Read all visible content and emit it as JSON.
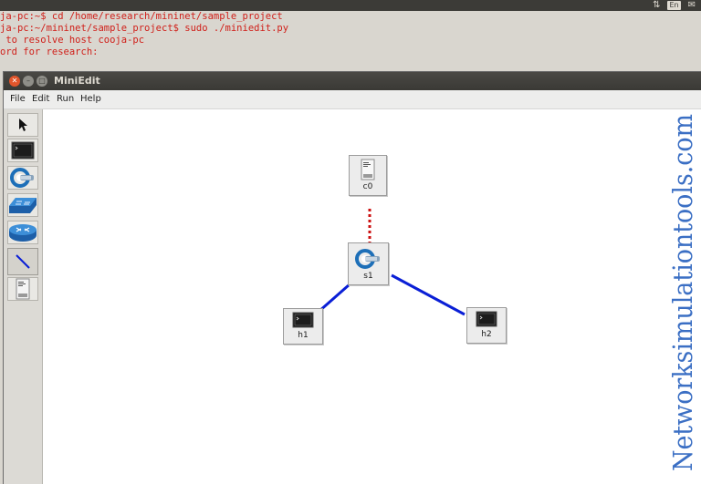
{
  "terminal": {
    "lines": [
      "ja-pc:~$ cd /home/research/mininet/sample_project",
      "ja-pc:~/mininet/sample_project$ sudo ./miniedit.py",
      " to resolve host cooja-pc",
      "ord for research:"
    ]
  },
  "system_tray": {
    "network_icon": "updown-arrows-icon",
    "keyboard_layout": "En",
    "mail_icon": "mail-icon"
  },
  "window": {
    "title": "MiniEdit",
    "controls": [
      "close",
      "minimize",
      "maximize"
    ]
  },
  "menu": {
    "items": [
      "File",
      "Edit",
      "Run",
      "Help"
    ]
  },
  "toolbar": {
    "tools": [
      {
        "name": "select",
        "icon": "arrow-pointer-icon"
      },
      {
        "name": "host",
        "icon": "terminal-icon"
      },
      {
        "name": "switch",
        "icon": "switch-icon"
      },
      {
        "name": "legacy-switch",
        "icon": "legacy-switch-icon"
      },
      {
        "name": "router",
        "icon": "router-icon"
      },
      {
        "name": "netlink",
        "icon": "link-line-icon"
      },
      {
        "name": "controller",
        "icon": "controller-icon"
      }
    ],
    "active_tool": "netlink"
  },
  "topology": {
    "nodes": [
      {
        "id": "c0",
        "label": "c0",
        "type": "controller"
      },
      {
        "id": "s1",
        "label": "s1",
        "type": "switch"
      },
      {
        "id": "h1",
        "label": "h1",
        "type": "host"
      },
      {
        "id": "h2",
        "label": "h2",
        "type": "host"
      }
    ],
    "links": [
      {
        "from": "c0",
        "to": "s1",
        "style": "controller-link",
        "color": "#cc1111"
      },
      {
        "from": "s1",
        "to": "h1",
        "style": "data-link",
        "color": "#0a1fd6"
      },
      {
        "from": "s1",
        "to": "h2",
        "style": "data-link",
        "color": "#0a1fd6"
      }
    ]
  },
  "watermark": {
    "text": "Networksimulationtools.com",
    "color": "#3b6fc4"
  }
}
